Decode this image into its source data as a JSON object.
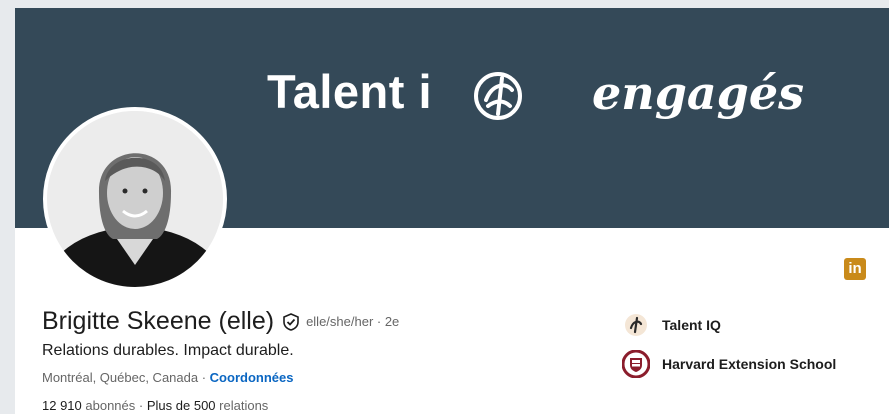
{
  "banner": {
    "brand_left": "Talent i",
    "brand_right": "engagés",
    "background": "#344958"
  },
  "profile": {
    "name": "Brigitte Skeene (elle)",
    "pronouns_degree": "elle/she/her · 2e",
    "headline": "Relations durables. Impact durable.",
    "location": "Montréal, Québec, Canada ·",
    "contact_link": "Coordonnées",
    "followers_count": "12 910",
    "followers_label": "abonnés",
    "separator": "·",
    "connections_count": "Plus de 500",
    "connections_label": "relations"
  },
  "social_badge": {
    "label": "in",
    "icon": "linkedin-icon",
    "color": "#c98a1a"
  },
  "organizations": [
    {
      "name": "Talent IQ",
      "icon": "talent-iq-logo-icon"
    },
    {
      "name": "Harvard Extension School",
      "icon": "harvard-shield-icon"
    }
  ],
  "colors": {
    "link": "#0a66c2",
    "text": "#1d1d1d",
    "muted": "#666666"
  }
}
